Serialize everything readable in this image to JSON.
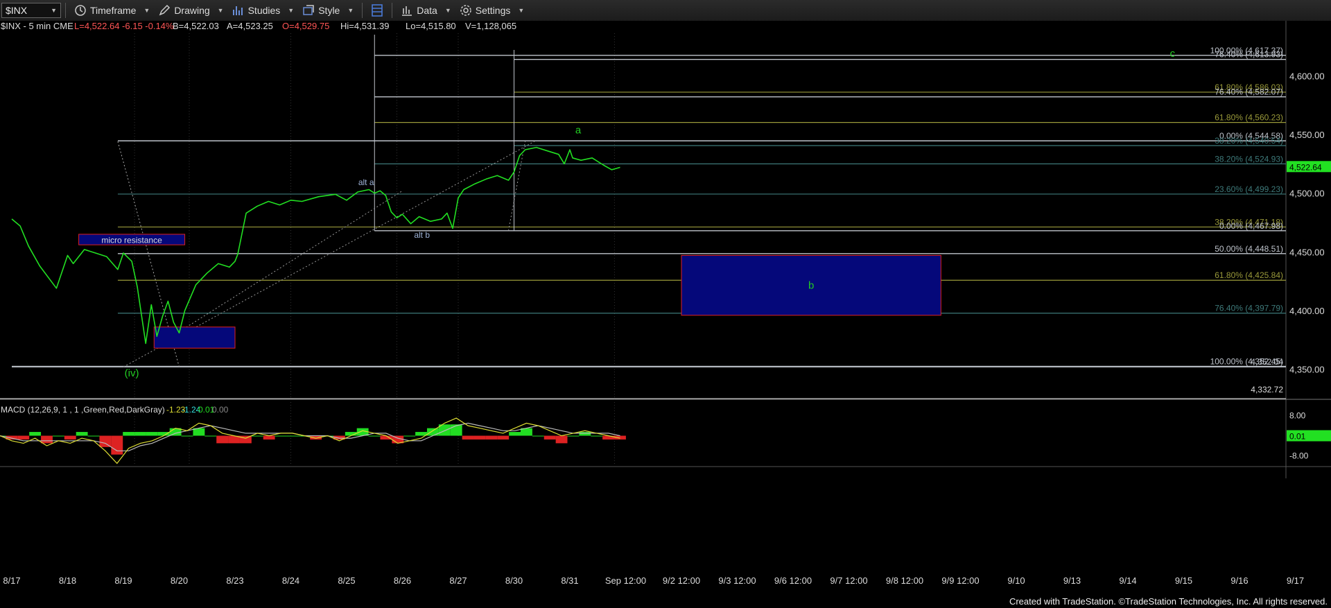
{
  "toolbar": {
    "symbol": "$INX",
    "buttons": [
      {
        "id": "timeframe",
        "label": "Timeframe",
        "icon": "clock-icon"
      },
      {
        "id": "drawing",
        "label": "Drawing",
        "icon": "pencil-icon"
      },
      {
        "id": "studies",
        "label": "Studies",
        "icon": "studies-icon"
      },
      {
        "id": "style",
        "label": "Style",
        "icon": "style-icon"
      },
      {
        "id": "layout",
        "label": "",
        "icon": "layout-icon"
      },
      {
        "id": "data",
        "label": "Data",
        "icon": "bar-chart-icon"
      },
      {
        "id": "settings",
        "label": "Settings",
        "icon": "gear-icon"
      }
    ]
  },
  "header": {
    "symbol_info": "$INX - 5 min  CME",
    "last": "L=4,522.64 -6.15 -0.14%",
    "bid": "B=4,522.03",
    "ask": "A=4,523.25",
    "open": "O=4,529.75",
    "high": "Hi=4,531.39",
    "low": "Lo=4,515.80",
    "volume": "V=1,128,065"
  },
  "colors": {
    "price": "#22e022",
    "fib_gray": "#bfc4cc",
    "fib_olive": "#9a9a3a",
    "fib_teal": "#3e7a7a",
    "box_fill": "#05087a",
    "box_border": "#e02020",
    "label_text": "#9fb4d8",
    "wave_green": "#22cc22",
    "macd_up": "#22dd22",
    "macd_down": "#dd2222",
    "macd_line": "#dddd33",
    "signal_line": "#bbbbbb"
  },
  "chart_data": {
    "type": "line",
    "title": "",
    "xlabel": "",
    "ylabel": "",
    "ylim": [
      4325,
      4635
    ],
    "x_ticks": [
      "8/17",
      "8/18",
      "8/19",
      "8/20",
      "8/23",
      "8/24",
      "8/25",
      "8/26",
      "8/27",
      "8/30",
      "8/31",
      "Sep 12:00",
      "9/2 12:00",
      "9/3 12:00",
      "9/6 12:00",
      "9/7 12:00",
      "9/8 12:00",
      "9/9 12:00",
      "9/10",
      "9/13",
      "9/14",
      "9/15",
      "9/16",
      "9/17"
    ],
    "y_ticks": [
      "4,600.00",
      "4,550.00",
      "4,500.00",
      "4,450.00",
      "4,400.00",
      "4,350.00"
    ],
    "current_price": "4,522.64",
    "low_price_label": "4,332.72",
    "series": [
      {
        "x": [
          0,
          0.15,
          0.3,
          0.5,
          0.8,
          1.0,
          1.1,
          1.3,
          1.5,
          1.7,
          1.9,
          2.0,
          2.15,
          2.25,
          2.4,
          2.5,
          2.6,
          2.7,
          2.8,
          2.9,
          3.0,
          3.1,
          3.3,
          3.5,
          3.7,
          3.9,
          4.0,
          4.05,
          4.2,
          4.4,
          4.6,
          4.8,
          5.0,
          5.2,
          5.5,
          5.8,
          6.0,
          6.2,
          6.4,
          6.5,
          6.6,
          6.7,
          6.8,
          6.9,
          7.0,
          7.15,
          7.3,
          7.5,
          7.7,
          7.8,
          7.9,
          8.0,
          8.1,
          8.3,
          8.5,
          8.7,
          8.9,
          9.0,
          9.1,
          9.2,
          9.4,
          9.6,
          9.8,
          9.9,
          10.0,
          10.05,
          10.2,
          10.4,
          10.6,
          10.75,
          10.9
        ],
        "y": [
          4478,
          4472,
          4455,
          4438,
          4419,
          4447,
          4440,
          4452,
          4449,
          4446,
          4435,
          4449,
          4442,
          4420,
          4372,
          4405,
          4378,
          4395,
          4408,
          4390,
          4381,
          4400,
          4422,
          4432,
          4440,
          4437,
          4442,
          4448,
          4483,
          4489,
          4493,
          4490,
          4494,
          4493,
          4497,
          4499,
          4494,
          4501,
          4503,
          4500,
          4502,
          4498,
          4484,
          4479,
          4482,
          4474,
          4480,
          4476,
          4478,
          4483,
          4470,
          4496,
          4503,
          4508,
          4512,
          4515,
          4511,
          4518,
          4532,
          4537,
          4539,
          4536,
          4533,
          4525,
          4537,
          4530,
          4528,
          4530,
          4524,
          4520,
          4522
        ]
      }
    ],
    "fib_levels": [
      {
        "label": "100.00% (4,617.37)",
        "value": 4617.37,
        "color": "gray",
        "x_start": 6.5
      },
      {
        "label": "76.40% (4,613.93)",
        "value": 4613.93,
        "color": "gray",
        "x_start": 9.0
      },
      {
        "label": "61.80% (4,586.03)",
        "value": 4586.03,
        "color": "olive",
        "x_start": 9.0
      },
      {
        "label": "76.40% (4,582.07)",
        "value": 4582.07,
        "color": "gray",
        "x_start": 6.5
      },
      {
        "label": "61.80% (4,560.23)",
        "value": 4560.23,
        "color": "olive",
        "x_start": 6.5
      },
      {
        "label": "0.00% (4,544.58)",
        "value": 4544.58,
        "color": "gray",
        "x_start": 1.9
      },
      {
        "label": "38.20% (4,540.54)",
        "value": 4540.54,
        "color": "teal",
        "x_start": 9.0
      },
      {
        "label": "38.20% (4,524.93)",
        "value": 4524.93,
        "color": "teal",
        "x_start": 6.5
      },
      {
        "label": "23.60% (4,499.23)",
        "value": 4499.23,
        "color": "teal",
        "x_start": 1.9
      },
      {
        "label": "38.20% (4,471.18)",
        "value": 4471.18,
        "color": "olive",
        "x_start": 1.9
      },
      {
        "label": "0.00% (4,467.98)",
        "value": 4467.98,
        "color": "gray",
        "x_start": 6.5
      },
      {
        "label": "50.00% (4,448.51)",
        "value": 4448.51,
        "color": "gray",
        "x_start": 1.9
      },
      {
        "label": "61.80% (4,425.84)",
        "value": 4425.84,
        "color": "olive",
        "x_start": 1.9
      },
      {
        "label": "76.40% (4,397.79)",
        "value": 4397.79,
        "color": "teal",
        "x_start": 1.9
      },
      {
        "label": "100.00% (4,352.45)",
        "value": 4352.45,
        "color": "gray",
        "x_start": 0
      },
      {
        "label": "4,352.04",
        "value": 4352.04,
        "color": "gray",
        "x_start": 0
      }
    ],
    "boxes": [
      {
        "label": "micro resistance",
        "x0": 1.2,
        "x1": 3.1,
        "y0": 4456,
        "y1": 4465,
        "label_inside": true
      },
      {
        "label": "",
        "x0": 2.55,
        "x1": 4.0,
        "y0": 4368,
        "y1": 4386,
        "label_inside": false
      },
      {
        "label": "b",
        "x0": 12.0,
        "x1": 16.65,
        "y0": 4396,
        "y1": 4447,
        "label_inside": true
      }
    ],
    "annotations": [
      {
        "text": "alt a",
        "x": 6.35,
        "y": 4507,
        "color": "blue"
      },
      {
        "text": "alt b",
        "x": 7.35,
        "y": 4462,
        "color": "blue"
      },
      {
        "text": "a",
        "x": 10.15,
        "y": 4551,
        "color": "green"
      },
      {
        "text": "c",
        "x": 20.8,
        "y": 4616,
        "color": "green"
      },
      {
        "text": "(iv)",
        "x": 2.15,
        "y": 4344,
        "color": "green"
      }
    ]
  },
  "macd": {
    "label": "MACD (12,26,9, 1 , 1 ,Green,Red,DarkGray)",
    "values": [
      "-1.23",
      "-1.24",
      "0.01",
      "0.00"
    ],
    "ylim": [
      -12,
      12
    ],
    "y_ticks": [
      "8.00",
      "-8.00"
    ],
    "current": "0.01",
    "macd_line": [
      0,
      -2,
      -3,
      -1,
      -4,
      -2,
      -3,
      -1,
      -2,
      -6,
      -11,
      -5,
      -3,
      -2,
      0,
      3,
      2,
      5,
      4,
      1,
      0,
      -1,
      1,
      0,
      1,
      1,
      0,
      -1,
      0,
      -2,
      0,
      2,
      1,
      0,
      -3,
      -2,
      -1,
      2,
      5,
      7,
      4,
      3,
      2,
      1,
      3,
      5,
      4,
      2,
      0,
      1,
      2,
      1,
      0,
      -1
    ],
    "signal_line": [
      0,
      -1,
      -2,
      -2,
      -2,
      -2,
      -2,
      -2,
      -2,
      -3,
      -6,
      -6,
      -4,
      -3,
      -1,
      1,
      2,
      3,
      4,
      3,
      2,
      1,
      1,
      1,
      1,
      1,
      0,
      0,
      0,
      -1,
      -1,
      0,
      1,
      1,
      -1,
      -2,
      -2,
      0,
      2,
      4,
      5,
      4,
      3,
      2,
      2,
      3,
      4,
      3,
      2,
      1,
      1,
      1,
      1,
      0
    ]
  },
  "footer": {
    "credit": "Created with TradeStation. ©TradeStation Technologies, Inc. All rights reserved."
  }
}
